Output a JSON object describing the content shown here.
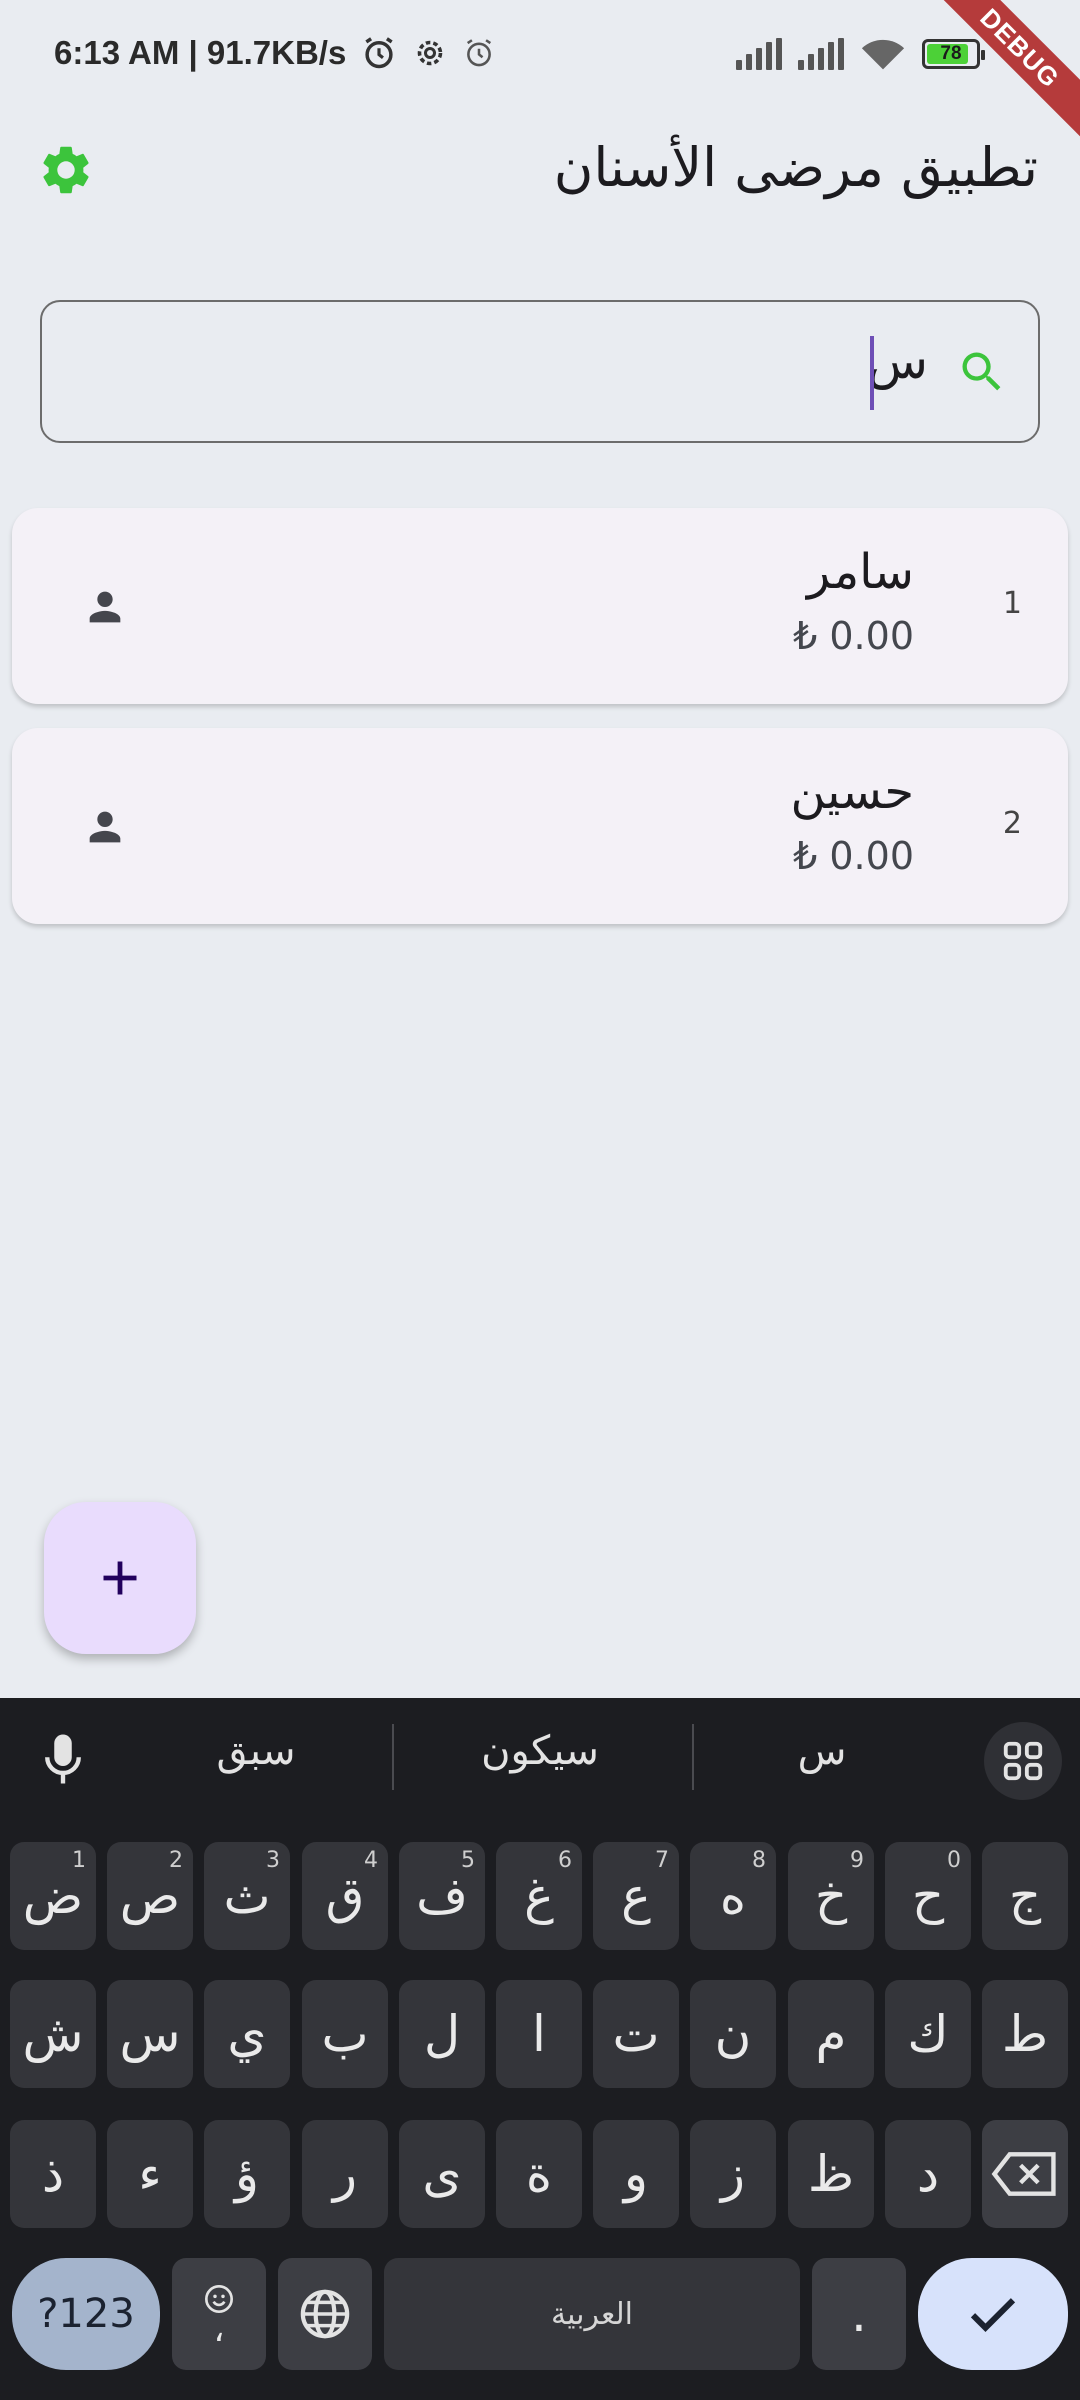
{
  "status_bar": {
    "time_speed": "6:13 AM | 91.7KB/s",
    "battery": "78"
  },
  "debug_banner": "DEBUG",
  "app_bar": {
    "title": "تطبيق مرضى الأسنان",
    "settings_icon": "gear-icon",
    "accent_color": "#3cc43c"
  },
  "search": {
    "value": "س",
    "icon": "search-icon"
  },
  "patients": [
    {
      "index": "1",
      "name": "سامر",
      "amount": "₺ 0.00"
    },
    {
      "index": "2",
      "name": "حسين",
      "amount": "₺ 0.00"
    }
  ],
  "fab": {
    "label": "+"
  },
  "keyboard": {
    "suggestions": [
      "س",
      "سيكون",
      "سبق"
    ],
    "row1": [
      {
        "k": "ج",
        "h": ""
      },
      {
        "k": "ح",
        "h": "0"
      },
      {
        "k": "خ",
        "h": "9"
      },
      {
        "k": "ه",
        "h": "8"
      },
      {
        "k": "ع",
        "h": "7"
      },
      {
        "k": "غ",
        "h": "6"
      },
      {
        "k": "ف",
        "h": "5"
      },
      {
        "k": "ق",
        "h": "4"
      },
      {
        "k": "ث",
        "h": "3"
      },
      {
        "k": "ص",
        "h": "2"
      },
      {
        "k": "ض",
        "h": "1"
      }
    ],
    "row2": [
      "ط",
      "ك",
      "م",
      "ن",
      "ت",
      "ا",
      "ل",
      "ب",
      "ي",
      "س",
      "ش"
    ],
    "row3": [
      "د",
      "ظ",
      "ز",
      "و",
      "ة",
      "ى",
      "ر",
      "ؤ",
      "ء",
      "ذ"
    ],
    "symbols_label": "?123",
    "emoji_comma": "،",
    "space_label": "العربية",
    "period_label": "."
  }
}
